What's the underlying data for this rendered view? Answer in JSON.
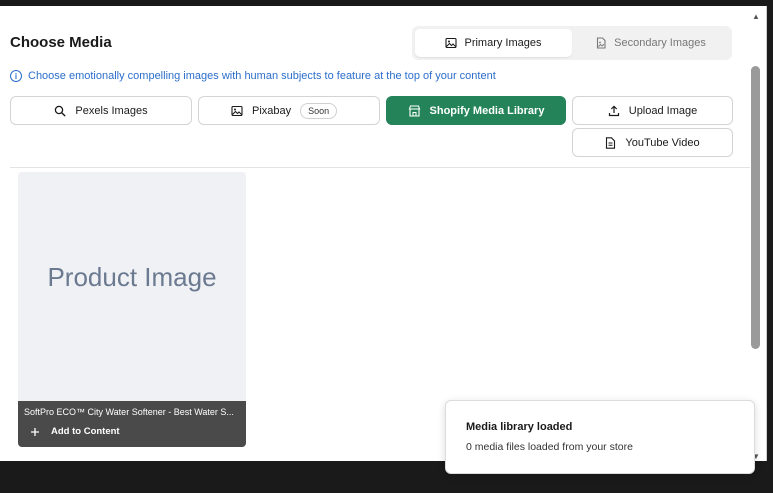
{
  "header": {
    "title": "Choose Media",
    "tabs": [
      {
        "label": "Primary Images",
        "icon": "image-icon",
        "active": true
      },
      {
        "label": "Secondary Images",
        "icon": "image-file-icon",
        "active": false
      }
    ]
  },
  "info": {
    "text": "Choose emotionally compelling images with human subjects to feature at the top of your content"
  },
  "sources": {
    "pexels": "Pexels Images",
    "pixabay": "Pixabay",
    "pixabay_badge": "Soon",
    "shopify": "Shopify Media Library",
    "upload": "Upload Image",
    "youtube": "YouTube Video"
  },
  "media": [
    {
      "placeholder": "Product Image",
      "caption": "SoftPro ECO™ City Water Softener - Best Water S...",
      "action": "Add to Content"
    }
  ],
  "toast": {
    "title": "Media library loaded",
    "message": "0 media files loaded from your store"
  },
  "colors": {
    "primary": "#248358",
    "info": "#2c6ecb",
    "card_bg": "#f0f1f5",
    "overlay": "#4a4a4a"
  }
}
